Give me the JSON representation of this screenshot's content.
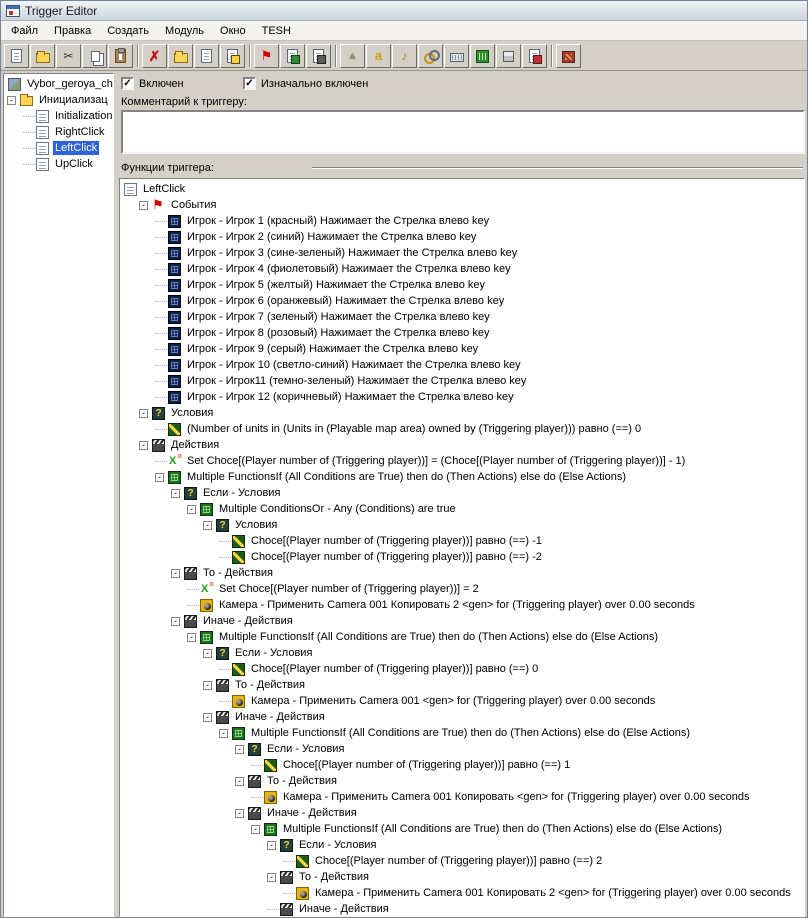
{
  "window": {
    "title": "Trigger Editor"
  },
  "menu": {
    "items": [
      {
        "id": "file",
        "label": "Файл"
      },
      {
        "id": "edit",
        "label": "Правка"
      },
      {
        "id": "create",
        "label": "Создать"
      },
      {
        "id": "module",
        "label": "Модуль"
      },
      {
        "id": "window",
        "label": "Окно"
      },
      {
        "id": "tesh",
        "label": "TESH"
      }
    ]
  },
  "toolbar": {
    "buttons": [
      {
        "id": "new-map",
        "icon": "page"
      },
      {
        "id": "open-map",
        "icon": "folder-open"
      },
      {
        "id": "cut",
        "icon": "cut",
        "glyph": "✂"
      },
      {
        "id": "copy",
        "icon": "copy"
      },
      {
        "id": "paste",
        "icon": "paste"
      },
      {
        "id": "sep1",
        "sep": true
      },
      {
        "id": "delete",
        "icon": "delete",
        "glyph": "✗"
      },
      {
        "id": "new-category",
        "icon": "folder"
      },
      {
        "id": "new-trigger",
        "icon": "page-lines"
      },
      {
        "id": "new-comment",
        "icon": "page-comment"
      },
      {
        "id": "sep2",
        "sep": true
      },
      {
        "id": "new-event",
        "icon": "flag",
        "glyph": "⚑"
      },
      {
        "id": "new-condition",
        "icon": "page-cond"
      },
      {
        "id": "new-action",
        "icon": "page-action"
      },
      {
        "id": "sep3",
        "sep": true
      },
      {
        "id": "terrain-editor",
        "icon": "terrain",
        "glyph": "▲"
      },
      {
        "id": "syntax-check",
        "icon": "syntax",
        "glyph": "a"
      },
      {
        "id": "sound-editor",
        "icon": "sound",
        "glyph": "♪"
      },
      {
        "id": "object-editor",
        "icon": "rings"
      },
      {
        "id": "campaign-editor",
        "icon": "keyboard"
      },
      {
        "id": "ai-editor",
        "icon": "ai"
      },
      {
        "id": "object-manager",
        "icon": "cube"
      },
      {
        "id": "import-manager",
        "icon": "page-import"
      },
      {
        "id": "sep4",
        "sep": true
      },
      {
        "id": "test-map",
        "icon": "test"
      }
    ]
  },
  "sidebar": {
    "nodes": [
      {
        "depth": 0,
        "icon": "map",
        "label": "Vybor_geroya_che"
      },
      {
        "depth": 0,
        "icon": "folder-open",
        "label": "Инициализац",
        "expander": true
      },
      {
        "depth": 1,
        "icon": "doc-lines",
        "label": "Initialization"
      },
      {
        "depth": 1,
        "icon": "doc",
        "label": "RightClick"
      },
      {
        "depth": 1,
        "icon": "doc",
        "label": "LeftClick",
        "selected": true
      },
      {
        "depth": 1,
        "icon": "doc",
        "label": "UpClick"
      }
    ]
  },
  "panel": {
    "enabled_label": "Включен",
    "enabled_checked": true,
    "initially_on_label": "Изначально включен",
    "initially_on_checked": true,
    "comment_label": "Комментарий к триггеру:",
    "comment_value": "",
    "functions_label": "Функции триггера:"
  },
  "tree": {
    "nodes": [
      {
        "depth": 0,
        "icon": "doc",
        "label": "LeftClick"
      },
      {
        "depth": 1,
        "icon": "flag",
        "label": "События",
        "expander": true
      },
      {
        "depth": 2,
        "icon": "event",
        "label": "Игрок - Игрок 1 (красный) Нажимает the Стрелка влево key"
      },
      {
        "depth": 2,
        "icon": "event",
        "label": "Игрок - Игрок 2 (синий) Нажимает the Стрелка влево key"
      },
      {
        "depth": 2,
        "icon": "event",
        "label": "Игрок - Игрок 3 (сине-зеленый) Нажимает the Стрелка влево key"
      },
      {
        "depth": 2,
        "icon": "event",
        "label": "Игрок - Игрок 4 (фиолетовый) Нажимает the Стрелка влево key"
      },
      {
        "depth": 2,
        "icon": "event",
        "label": "Игрок - Игрок 5 (желтый) Нажимает the Стрелка влево key"
      },
      {
        "depth": 2,
        "icon": "event",
        "label": "Игрок - Игрок 6 (оранжевый) Нажимает the Стрелка влево key"
      },
      {
        "depth": 2,
        "icon": "event",
        "label": "Игрок - Игрок 7 (зеленый) Нажимает the Стрелка влево key"
      },
      {
        "depth": 2,
        "icon": "event",
        "label": "Игрок - Игрок 8 (розовый) Нажимает the Стрелка влево key"
      },
      {
        "depth": 2,
        "icon": "event",
        "label": "Игрок - Игрок 9 (серый) Нажимает the Стрелка влево key"
      },
      {
        "depth": 2,
        "icon": "event",
        "label": "Игрок - Игрок 10 (светло-синий) Нажимает the Стрелка влево key"
      },
      {
        "depth": 2,
        "icon": "event",
        "label": "Игрок - Игрок11 (темно-зеленый) Нажимает the Стрелка влево key"
      },
      {
        "depth": 2,
        "icon": "event",
        "label": "Игрок - Игрок 12 (коричневый) Нажимает the Стрелка влево key"
      },
      {
        "depth": 1,
        "icon": "question",
        "label": "Условия",
        "expander": true
      },
      {
        "depth": 2,
        "icon": "condition",
        "label": "(Number of units in (Units in (Playable map area) owned by (Triggering player))) равно (==) 0"
      },
      {
        "depth": 1,
        "icon": "clapper",
        "label": "Действия",
        "expander": true
      },
      {
        "depth": 2,
        "icon": "setvar",
        "label": "Set Choce[(Player number of (Triggering player))] = (Choce[(Player number of (Triggering player))] - 1)"
      },
      {
        "depth": 2,
        "icon": "ifelse",
        "label": "Multiple FunctionsIf (All Conditions are True) then do (Then Actions) else do (Else Actions)",
        "expander": true
      },
      {
        "depth": 3,
        "icon": "question",
        "label": "Если - Условия",
        "expander": true
      },
      {
        "depth": 4,
        "icon": "ifelse",
        "label": "Multiple ConditionsOr - Any (Conditions) are true",
        "expander": true
      },
      {
        "depth": 5,
        "icon": "question",
        "label": "Условия",
        "expander": true
      },
      {
        "depth": 6,
        "icon": "condition",
        "label": "Choce[(Player number of (Triggering player))] равно (==) -1"
      },
      {
        "depth": 6,
        "icon": "condition",
        "label": "Choce[(Player number of (Triggering player))] равно (==) -2"
      },
      {
        "depth": 3,
        "icon": "clapper",
        "label": "То - Действия",
        "expander": true
      },
      {
        "depth": 4,
        "icon": "setvar",
        "label": "Set Choce[(Player number of (Triggering player))] = 2"
      },
      {
        "depth": 4,
        "icon": "camera",
        "label": "Камера - Применить Camera 001 Копировать 2 <gen> for (Triggering player) over 0.00 seconds"
      },
      {
        "depth": 3,
        "icon": "clapper",
        "label": "Иначе - Действия",
        "expander": true
      },
      {
        "depth": 4,
        "icon": "ifelse",
        "label": "Multiple FunctionsIf (All Conditions are True) then do (Then Actions) else do (Else Actions)",
        "expander": true
      },
      {
        "depth": 5,
        "icon": "question",
        "label": "Если - Условия",
        "expander": true
      },
      {
        "depth": 6,
        "icon": "condition",
        "label": "Choce[(Player number of (Triggering player))] равно (==) 0"
      },
      {
        "depth": 5,
        "icon": "clapper",
        "label": "То - Действия",
        "expander": true
      },
      {
        "depth": 6,
        "icon": "camera",
        "label": "Камера - Применить Camera 001 <gen> for (Triggering player) over 0.00 seconds"
      },
      {
        "depth": 5,
        "icon": "clapper",
        "label": "Иначе - Действия",
        "expander": true
      },
      {
        "depth": 6,
        "icon": "ifelse",
        "label": "Multiple FunctionsIf (All Conditions are True) then do (Then Actions) else do (Else Actions)",
        "expander": true
      },
      {
        "depth": 7,
        "icon": "question",
        "label": "Если - Условия",
        "expander": true
      },
      {
        "depth": 8,
        "icon": "condition",
        "label": "Choce[(Player number of (Triggering player))] равно (==) 1"
      },
      {
        "depth": 7,
        "icon": "clapper",
        "label": "То - Действия",
        "expander": true
      },
      {
        "depth": 8,
        "icon": "camera",
        "label": "Камера - Применить Camera 001 Копировать <gen> for (Triggering player) over 0.00 seconds"
      },
      {
        "depth": 7,
        "icon": "clapper",
        "label": "Иначе - Действия",
        "expander": true
      },
      {
        "depth": 8,
        "icon": "ifelse",
        "label": "Multiple FunctionsIf (All Conditions are True) then do (Then Actions) else do (Else Actions)",
        "expander": true
      },
      {
        "depth": 9,
        "icon": "question",
        "label": "Если - Условия",
        "expander": true
      },
      {
        "depth": 10,
        "icon": "condition",
        "label": "Choce[(Player number of (Triggering player))] равно (==) 2"
      },
      {
        "depth": 9,
        "icon": "clapper",
        "label": "То - Действия",
        "expander": true
      },
      {
        "depth": 10,
        "icon": "camera",
        "label": "Камера - Применить Camera 001 Копировать 2 <gen> for (Triggering player) over 0.00 seconds"
      },
      {
        "depth": 9,
        "icon": "clapper",
        "label": "Иначе - Действия"
      }
    ]
  }
}
